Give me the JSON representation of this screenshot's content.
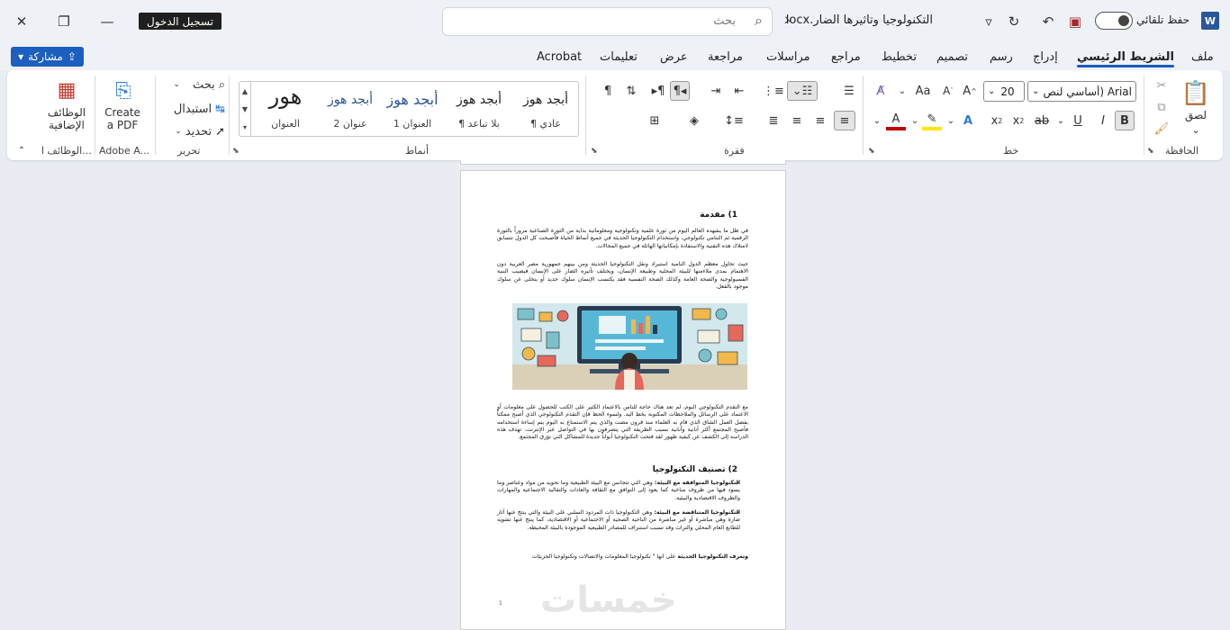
{
  "window": {
    "login_label": "تسجيل الدخول",
    "search_placeholder": "بحث",
    "doc_title": "التكنولوجيا وتأثيرها الضار.docx",
    "autosave_label": "حفظ تلقائي",
    "app_icon_letter": "W"
  },
  "tabs": {
    "share_label": "مشاركة",
    "items": [
      "ملف",
      "الشريط الرئيسي",
      "إدراج",
      "رسم",
      "تصميم",
      "تخطيط",
      "مراجع",
      "مراسلات",
      "مراجعة",
      "عرض",
      "تعليمات",
      "Acrobat"
    ],
    "active": "الشريط الرئيسي"
  },
  "ribbon": {
    "clipboard": {
      "group": "الحافظة",
      "paste": "لصق"
    },
    "font": {
      "group": "خط",
      "font_name": "Arial (أساسي لنص",
      "font_size": "20"
    },
    "paragraph": {
      "group": "فقرة"
    },
    "styles": {
      "group": "أنماط",
      "items": [
        {
          "sample": "أبجد هوز",
          "name": "¶ عادي"
        },
        {
          "sample": "أبجد هوز",
          "name": "¶ بلا تباعد"
        },
        {
          "sample": "أبجد هوز",
          "name": "العنوان 1"
        },
        {
          "sample": "أبجد هوز",
          "name": "عنوان 2"
        },
        {
          "sample": "هور",
          "name": "العنوان"
        }
      ]
    },
    "editing": {
      "group": "تحرير",
      "find": "بحث",
      "replace": "استبدال",
      "select": "تحديد"
    },
    "adobe": {
      "group": "Adobe A...",
      "create_pdf_line1": "Create",
      "create_pdf_line2": "a PDF"
    },
    "addins": {
      "group": "الوظائف ا...",
      "label_line1": "الوظائف",
      "label_line2": "الإضافية"
    }
  },
  "document": {
    "heading1": "1) مقدمة",
    "para1": "في ظل ما يشهده العالم اليوم من ثورة علمية وتكنولوجية ومعلوماتية بداية من الثورة الصناعية مروراً بالثورة الرقمية ثم التنامي تكنولوجي، واستخدام التكنولوجيا الحديثة في جميع أنماط الحياة فأصبحت كل الدول تتسابق لامتلاك هذه التقنية والاستفادة بإمكانياتها الهائلة في جميع المجالات.",
    "para2": "حيث تحاول معظم الدول النامية استيراد ونقل التكنولوجيا الحديثة ومن بينهم جمهورية مصر العربية دون الاهتمام بمدى ملاءمتها للبيئة المحلية وطبيعة الإنسان، ويختلف تأثيره الضار على الإنسان فيصيب البنية الفسيولوجية والصحة العامة وكذلك الصحة النفسية فقد يكتسب الإنسان سلوك جديد أو يتخلى عن سلوك موجود بالفعل.",
    "para3": "مع التقدم التكنولوجي اليوم، لم تعد هناك حاجة للناس بالاعتماد الكثير على الكتب للحصول على معلومات أو الاعتماد على الرسائل والملاحظات المكتوبة بخط اليد. ولسوء الحظ فإن التقدم التكنولوجي الذي أصبح ممكناً بفضل العمل الشاق الذي قام به العلماء منذ قرون مضت والذي يتم الاستمتاع به اليوم يتم إساءة استخدامه فأصبح المجتمع أكثر أنانية وأنانية بسبب الطريقة التي يتصرفون بها في التواصل عبر الإنترنت. تهدف هذه الدراسة إلى الكشف عن كيفية ظهور لقد فتحت التكنولوجيا أبواباً جديدة للمشاكل التي تؤرق المجتمع.",
    "heading2": "2) تصنيف التكنولوجيا",
    "bullet1_bold": "التكنولوجيا المتوافقة مع البيئة:",
    "bullet1": " وهي التي تتجانس مع البيئة الطبيعية وما تحويه من مواد وعناصر وما يسود فيها من ظروف مناخية كما يعود إلى التوافق مع الثقافة والعادات والتقاليد الاجتماعية والمهارات والظروف الاقتصادية والبيئية.",
    "bullet2_bold": "التكنولوجيا المتناقضة مع البيئة:",
    "bullet2": " وهي التكنولوجيا ذات المردود السلبي على البيئة والتي ينتج عنها آثار ضارة وهي مباشرة أو غير مباشرة من الناحية الصحية أو الاجتماعية أو الاقتصادية، كما ينتج عنها تشويه للطابع العام المحلي والتراث وقد تسبب استنزاف للمصادر الطبيعية الموجودة بالبيئة المحيطة.",
    "para4_bold": "وتعرف التكنولوجيا الحديثة",
    "para4": " على أنها \" تكنولوجيا المعلومات والاتصالات وتكنولوجيا الجزيئات",
    "page_number": "1",
    "watermark": "خمسات"
  },
  "colors": {
    "accent": "#185abd",
    "share": "#1b5fbf",
    "font_red": "#c00000",
    "highlight": "#ffe600"
  }
}
